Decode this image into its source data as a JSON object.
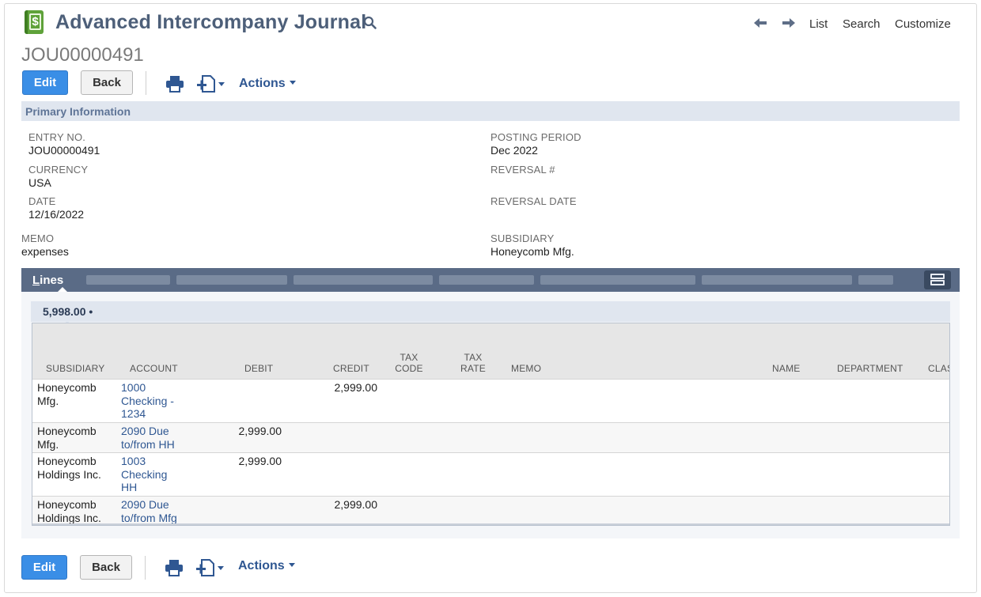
{
  "header": {
    "title": "Advanced Intercompany Journal",
    "record_id": "JOU00000491",
    "icon": "journal-dollar-icon",
    "nav": {
      "list": "List",
      "search": "Search",
      "customize": "Customize"
    }
  },
  "toolbar": {
    "edit_label": "Edit",
    "back_label": "Back",
    "actions_label": "Actions"
  },
  "primary_info": {
    "section_title": "Primary Information",
    "fields": {
      "entry_no": {
        "label": "ENTRY NO.",
        "value": "JOU00000491"
      },
      "currency": {
        "label": "CURRENCY",
        "value": "USA"
      },
      "date": {
        "label": "DATE",
        "value": "12/16/2022"
      },
      "memo": {
        "label": "MEMO",
        "value": "expenses"
      },
      "posting_period": {
        "label": "POSTING PERIOD",
        "value": "Dec 2022"
      },
      "reversal_no": {
        "label": "REVERSAL #",
        "value": ""
      },
      "reversal_date": {
        "label": "REVERSAL DATE",
        "value": ""
      },
      "subsidiary": {
        "label": "SUBSIDIARY",
        "value": "Honeycomb Mfg."
      }
    }
  },
  "lines": {
    "tab_label_underlined": "L",
    "tab_label_rest": "ines",
    "total": "5,998.00 •",
    "columns": {
      "subsidiary": "SUBSIDIARY",
      "account": "ACCOUNT",
      "debit": "DEBIT",
      "credit": "CREDIT",
      "tax_code_1": "TAX",
      "tax_code_2": "CODE",
      "tax_rate_1": "TAX",
      "tax_rate_2": "RATE",
      "memo": "MEMO",
      "name": "NAME",
      "department": "DEPARTMENT",
      "class": "CLAS"
    },
    "rows": [
      {
        "subsidiary": [
          "Honeycomb",
          "Mfg."
        ],
        "account": [
          "1000",
          "Checking -",
          "1234"
        ],
        "debit": "",
        "credit": "2,999.00"
      },
      {
        "subsidiary": [
          "Honeycomb",
          "Mfg."
        ],
        "account": [
          "2090 Due",
          "to/from HH"
        ],
        "debit": "2,999.00",
        "credit": ""
      },
      {
        "subsidiary": [
          "Honeycomb",
          "Holdings Inc."
        ],
        "account": [
          "1003",
          "Checking",
          "HH"
        ],
        "debit": "2,999.00",
        "credit": ""
      },
      {
        "subsidiary": [
          "Honeycomb",
          "Holdings Inc."
        ],
        "account": [
          "2090 Due",
          "to/from Mfg"
        ],
        "debit": "",
        "credit": "2,999.00"
      }
    ]
  },
  "colors": {
    "title": "#4d5f79",
    "primary_button": "#3a8ee6",
    "link": "#2f5792",
    "section_bar": "#e0e6ef",
    "lines_bar": "#5a6b86"
  }
}
